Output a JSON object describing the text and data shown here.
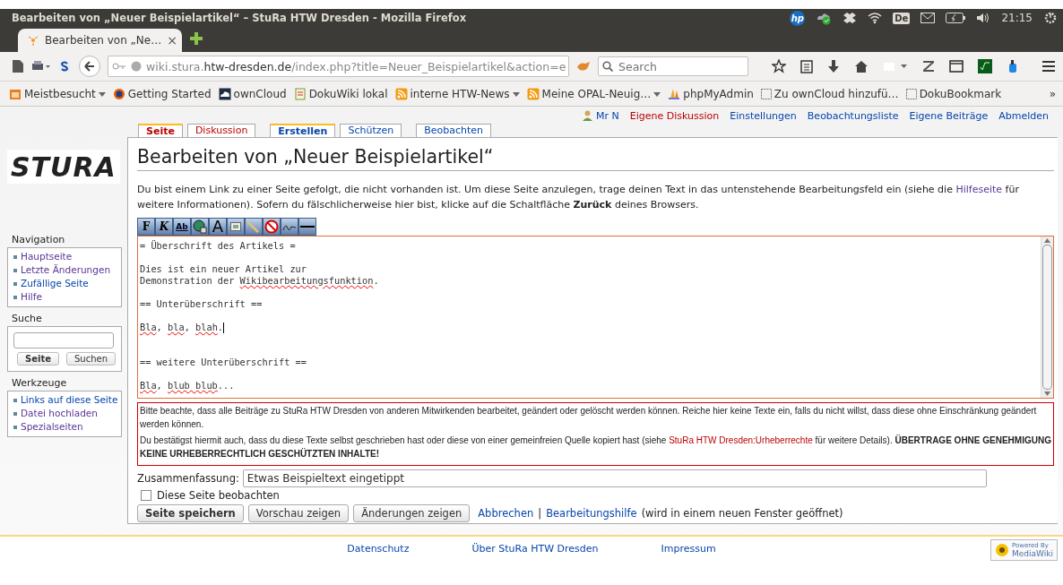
{
  "window": {
    "title": "Bearbeiten von „Neuer Beispielartikel“ – StuRa HTW Dresden - Mozilla Firefox"
  },
  "system_tray": {
    "logo": "hp",
    "keyboard_layout": "De",
    "clock": "21:15"
  },
  "browser": {
    "tab": {
      "title": "Bearbeiten von „Ne…",
      "close": "×"
    },
    "url": {
      "prefix": "wiki.stura.",
      "domain": "htw-dresden.de",
      "path": "/index.php?title=Neuer_Beispielartikel&action=e"
    },
    "search": {
      "placeholder": "Search"
    },
    "bookmarks": [
      {
        "label": "Meistbesucht",
        "kind": "smart",
        "menu": true
      },
      {
        "label": "Getting Started",
        "kind": "firefox",
        "menu": false
      },
      {
        "label": "ownCloud",
        "kind": "cloud",
        "menu": false
      },
      {
        "label": "DokuWiki lokal",
        "kind": "wiki",
        "menu": false
      },
      {
        "label": "interne HTW-News",
        "kind": "feed",
        "menu": true
      },
      {
        "label": "Meine OPAL-Neuig…",
        "kind": "feed",
        "menu": true
      },
      {
        "label": "phpMyAdmin",
        "kind": "pma",
        "menu": false
      },
      {
        "label": "Zu ownCloud hinzufü…",
        "kind": "page",
        "menu": false
      },
      {
        "label": "DokuBookmark",
        "kind": "page",
        "menu": false
      }
    ],
    "bookmarks_overflow": "»"
  },
  "personal_links": [
    {
      "label": "Mr N",
      "kind": "user"
    },
    {
      "label": "Eigene Diskussion",
      "kind": "new"
    },
    {
      "label": "Einstellungen",
      "kind": "link"
    },
    {
      "label": "Beobachtungsliste",
      "kind": "link"
    },
    {
      "label": "Eigene Beiträge",
      "kind": "link"
    },
    {
      "label": "Abmelden",
      "kind": "link"
    }
  ],
  "tab_groups": [
    [
      {
        "label": "Seite",
        "selected": true,
        "exists": false
      },
      {
        "label": "Diskussion",
        "selected": false,
        "exists": false
      }
    ],
    [
      {
        "label": "Erstellen",
        "selected": true,
        "exists": true
      },
      {
        "label": "Schützen",
        "selected": false,
        "exists": true
      }
    ],
    [
      {
        "label": "Beobachten",
        "selected": false,
        "exists": true
      }
    ]
  ],
  "sidebar": {
    "logo": "STURA",
    "navigation": {
      "heading": "Navigation",
      "items": [
        {
          "label": "Hauptseite",
          "visited": true
        },
        {
          "label": "Letzte Änderungen",
          "visited": true
        },
        {
          "label": "Zufällige Seite",
          "visited": false
        },
        {
          "label": "Hilfe",
          "visited": true
        }
      ]
    },
    "search": {
      "heading": "Suche",
      "buttons": [
        "Seite",
        "Suchen"
      ]
    },
    "tools": {
      "heading": "Werkzeuge",
      "items": [
        {
          "label": "Links auf diese Seite",
          "visited": false
        },
        {
          "label": "Datei hochladen",
          "visited": true
        },
        {
          "label": "Spezialseiten",
          "visited": true
        }
      ]
    }
  },
  "heading": "Bearbeiten von „Neuer Beispielartikel“",
  "intro": {
    "before": "Du bist einem Link zu einer Seite gefolgt, die nicht vorhanden ist. Um diese Seite anzulegen, trage deinen Text in das untenstehende Bearbeitungsfeld ein (siehe die ",
    "link": "Hilfeseite",
    "after": " für weitere Informationen). Sofern du fälschlicherweise hier bist, klicke auf die Schaltfläche **Zurück** deines Browsers."
  },
  "editor_toolbar": [
    {
      "kind": "bold",
      "label": "F"
    },
    {
      "kind": "italic",
      "label": "K"
    },
    {
      "kind": "link",
      "label": "Ab"
    },
    {
      "kind": "globe"
    },
    {
      "kind": "headline",
      "label": "A"
    },
    {
      "kind": "image"
    },
    {
      "kind": "media"
    },
    {
      "kind": "nowiki"
    },
    {
      "kind": "signature"
    },
    {
      "kind": "rule"
    }
  ],
  "editor_lines": [
    {
      "kind": "text",
      "segments": [
        {
          "text": "= Überschrift des Artikels =",
          "misspelled": false
        }
      ]
    },
    {
      "kind": "blank"
    },
    {
      "kind": "text",
      "segments": [
        {
          "text": "Dies ist ein neuer Artikel zur",
          "misspelled": false
        }
      ]
    },
    {
      "kind": "text",
      "segments": [
        {
          "text": "Demonstration der ",
          "misspelled": false
        },
        {
          "text": "Wikibearbeitungsfunktion",
          "misspelled": true
        },
        {
          "text": ".",
          "misspelled": false
        }
      ]
    },
    {
      "kind": "blank"
    },
    {
      "kind": "text",
      "segments": [
        {
          "text": "== Unterüberschrift ==",
          "misspelled": false
        }
      ]
    },
    {
      "kind": "blank"
    },
    {
      "kind": "cursor",
      "segments": [
        {
          "text": "Bla",
          "misspelled": true
        },
        {
          "text": ", ",
          "misspelled": false
        },
        {
          "text": "bla",
          "misspelled": true
        },
        {
          "text": ", ",
          "misspelled": false
        },
        {
          "text": "blah",
          "misspelled": true
        },
        {
          "text": ".",
          "misspelled": false
        }
      ]
    },
    {
      "kind": "blank"
    },
    {
      "kind": "blank"
    },
    {
      "kind": "text",
      "segments": [
        {
          "text": "== weitere Unterüberschrift ==",
          "misspelled": false
        }
      ]
    },
    {
      "kind": "blank"
    },
    {
      "kind": "text",
      "segments": [
        {
          "text": "Bla",
          "misspelled": true
        },
        {
          "text": ", ",
          "misspelled": false
        },
        {
          "text": "blub blub",
          "misspelled": true
        },
        {
          "text": "...",
          "misspelled": false
        }
      ]
    }
  ],
  "warning": {
    "paragraph_1": "Bitte beachte, dass alle Beiträge zu StuRa HTW Dresden von anderen Mitwirkenden bearbeitet, geändert oder gelöscht werden können. Reiche hier keine Texte ein, falls du nicht willst, dass diese ohne Einschränkung geändert werden können.",
    "paragraph_2": {
      "before": "Du bestätigst hiermit auch, dass du diese Texte selbst geschrieben hast oder diese von einer gemeinfreien Quelle kopiert hast (siehe ",
      "link": "StuRa HTW Dresden:Urheberrechte",
      "after": " für weitere Details). **ÜBERTRAGE OHNE GENEHMIGUNG KEINE URHEBERRECHTLICH GESCHÜTZTEN INHALTE!**"
    }
  },
  "summary": {
    "label": "Zusammenfassung:",
    "value": "Etwas Beispieltext eingetippt"
  },
  "watch": {
    "label": "Diese Seite beobachten",
    "checked": false
  },
  "buttons": [
    {
      "label": "Seite speichern",
      "primary": true
    },
    {
      "label": "Vorschau zeigen",
      "primary": false
    },
    {
      "label": "Änderungen zeigen",
      "primary": false
    }
  ],
  "cancel_link": "Abbrechen",
  "separator": "|",
  "help_link": "Bearbeitungshilfe",
  "help_note": "(wird in einem neuen Fenster geöffnet)",
  "footer": {
    "links": [
      "Datenschutz",
      "Über StuRa HTW Dresden",
      "Impressum"
    ],
    "badge_top": "Powered By",
    "badge_bottom": "MediaWiki"
  }
}
